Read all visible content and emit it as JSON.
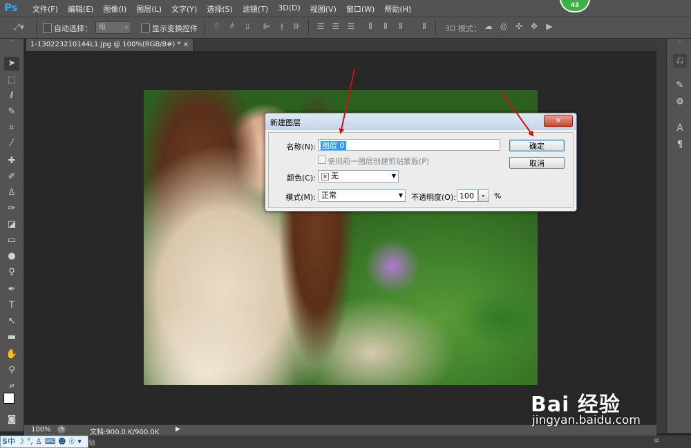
{
  "app": {
    "logo": "Ps"
  },
  "menubar": {
    "items": [
      "文件(F)",
      "编辑(E)",
      "图像(I)",
      "图层(L)",
      "文字(Y)",
      "选择(S)",
      "滤镜(T)",
      "3D(D)",
      "视图(V)",
      "窗口(W)",
      "帮助(H)"
    ],
    "badge": "43"
  },
  "options_bar": {
    "auto_select_label": "自动选择：",
    "auto_select_value": "组",
    "show_transform_label": "显示变换控件",
    "mode_3d_label": "3D 模式："
  },
  "document_tab": {
    "label": "1-130223210144L1.jpg @ 100%(RGB/8#) *",
    "close": "×"
  },
  "dialog": {
    "title": "新建图层",
    "close_glyph": "✕",
    "name_label": "名称(N):",
    "name_value": "图层 0",
    "clip_checkbox_label": "使用前一图层创建剪贴蒙版(P)",
    "color_label": "颜色(C):",
    "color_value": "无",
    "mode_label": "模式(M):",
    "mode_value": "正常",
    "opacity_label": "不透明度(O):",
    "opacity_value": "100",
    "opacity_unit": "%",
    "ok_label": "确定",
    "cancel_label": "取消"
  },
  "status_bar": {
    "zoom": "100%",
    "doc_info": "文档:900.0 K/900.0K",
    "timeline": "轴"
  },
  "ime": {
    "text": "中 ☽ °, ♙ ⌨ ☻ ☉ ▾"
  },
  "watermark": {
    "logo": "Bai 经验",
    "url": "jingyan.baidu.com"
  },
  "colors": {
    "accent": "#31a8ff",
    "panel": "#535353",
    "canvas_bg": "#282828",
    "arrow": "#d01010",
    "selection": "#3399ff"
  }
}
